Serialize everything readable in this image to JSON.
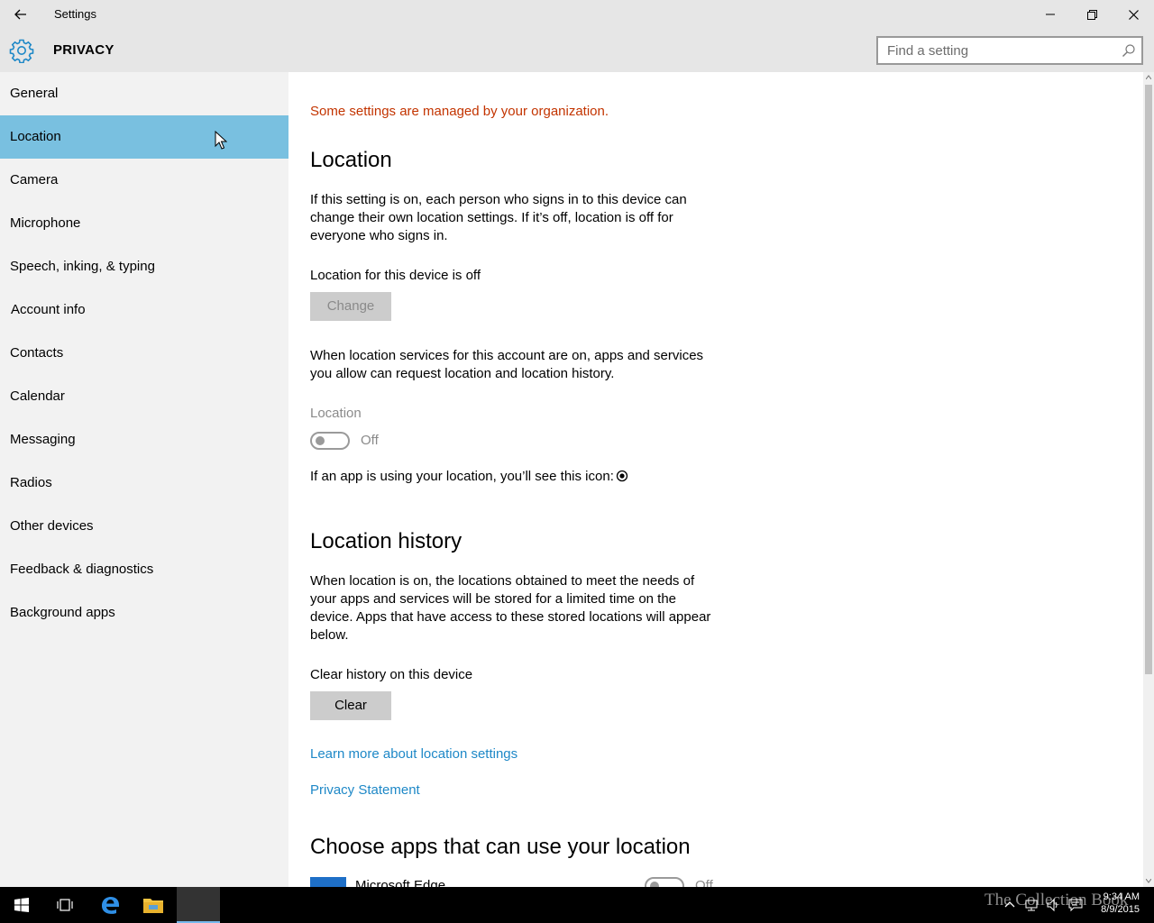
{
  "window": {
    "title": "Settings"
  },
  "header": {
    "section_title": "PRIVACY",
    "search_placeholder": "Find a setting"
  },
  "sidebar": {
    "items": [
      {
        "label": "General"
      },
      {
        "label": "Location",
        "active": true
      },
      {
        "label": "Camera"
      },
      {
        "label": "Microphone"
      },
      {
        "label": "Speech, inking, & typing"
      },
      {
        "label": "Account info"
      },
      {
        "label": "Contacts"
      },
      {
        "label": "Calendar"
      },
      {
        "label": "Messaging"
      },
      {
        "label": "Radios"
      },
      {
        "label": "Other devices"
      },
      {
        "label": "Feedback & diagnostics"
      },
      {
        "label": "Background apps"
      }
    ]
  },
  "main": {
    "managed_notice": "Some settings are managed by your organization.",
    "location": {
      "heading": "Location",
      "description": "If this setting is on, each person who signs in to this device can change their own location settings. If it’s off, location is off for everyone who signs in.",
      "device_status": "Location for this device is off",
      "change_button": "Change",
      "account_description": "When location services for this account are on, apps and services you allow can request location and location history.",
      "toggle_label": "Location",
      "toggle_state": "Off",
      "icon_hint": "If an app is using your location, you’ll see this icon:"
    },
    "history": {
      "heading": "Location history",
      "description": "When location is on, the locations obtained to meet the needs of your apps and services will be stored for a limited time on the device. Apps that have access to these stored locations will appear below.",
      "clear_label": "Clear history on this device",
      "clear_button": "Clear",
      "learn_more_link": "Learn more about location settings",
      "privacy_link": "Privacy Statement"
    },
    "apps": {
      "heading": "Choose apps that can use your location",
      "items": [
        {
          "name": "Microsoft Edge",
          "state": "Off"
        }
      ]
    }
  },
  "taskbar": {
    "watermark": "The Collection Book",
    "time": "9:34 AM",
    "date": "8/9/2015"
  },
  "colors": {
    "accent": "#79c0e0",
    "warning": "#c33400",
    "link": "#1e88c7",
    "sidebar_bg": "#f2f2f2",
    "titlebar_bg": "#e6e6e6"
  }
}
